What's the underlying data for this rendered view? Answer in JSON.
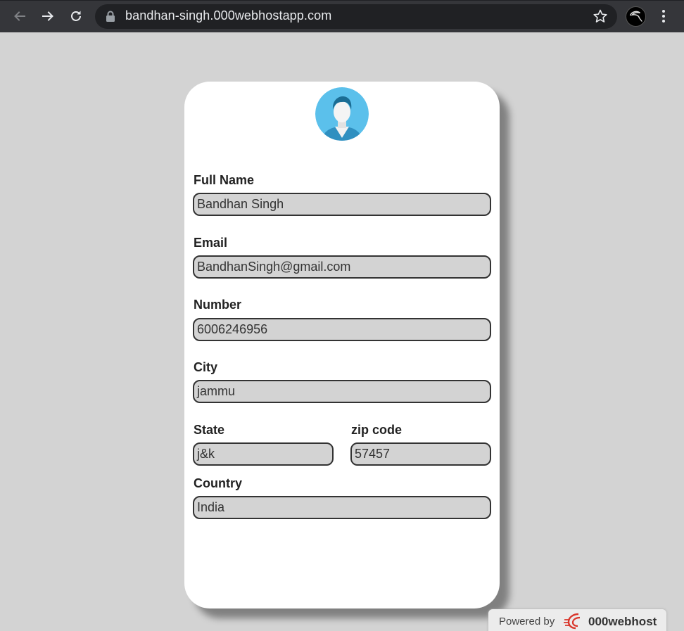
{
  "browser": {
    "url": "bandhan-singh.000webhostapp.com"
  },
  "form": {
    "full_name_label": "Full Name",
    "full_name_value": "Bandhan Singh",
    "email_label": "Email",
    "email_value": "BandhanSingh@gmail.com",
    "number_label": "Number",
    "number_value": "6006246956",
    "city_label": "City",
    "city_value": "jammu",
    "state_label": "State",
    "state_value": "j&k",
    "zip_label": "zip code",
    "zip_value": "57457",
    "country_label": "Country",
    "country_value": "India"
  },
  "footer": {
    "powered_by": "Powered by",
    "brand": "000webhost"
  },
  "icons": {
    "back": "back-arrow-icon",
    "forward": "forward-arrow-icon",
    "reload": "reload-icon",
    "lock": "lock-icon",
    "star": "star-icon",
    "profile": "profile-avatar-icon",
    "menu": "menu-dots-icon",
    "avatar": "user-avatar-icon"
  },
  "colors": {
    "toolbar": "#35363a",
    "omnibox": "#202124",
    "page_background": "#d3d3d3",
    "field_background": "#d3d3d3",
    "avatar_background": "#5bc0eb",
    "brand_red": "#d9362b"
  }
}
